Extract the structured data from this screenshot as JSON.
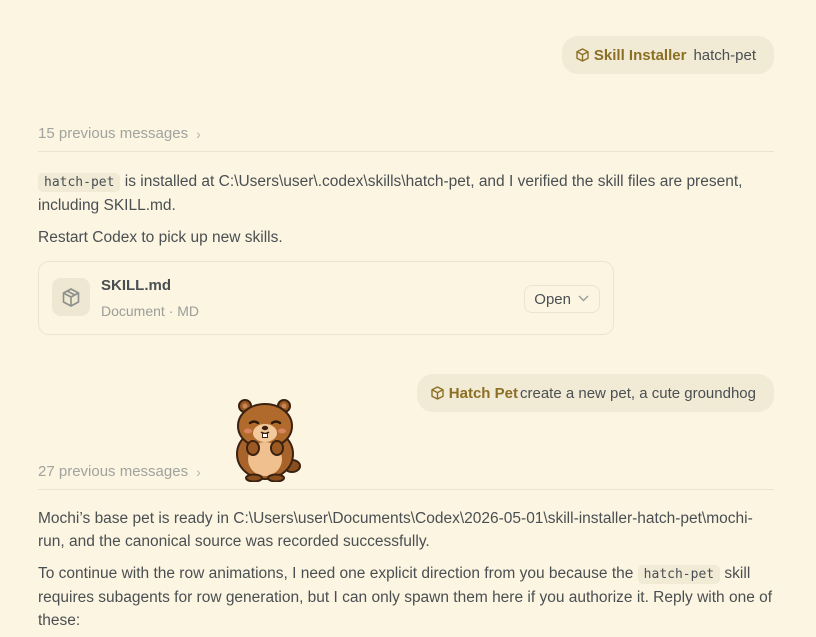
{
  "messages": {
    "first_request": {
      "skill_name": "Skill Installer",
      "text": "hatch-pet"
    },
    "first_previous": {
      "label": "15 previous messages",
      "chevron": "›"
    },
    "first_reply": {
      "code": "hatch-pet",
      "line1": " is installed at C:\\Users\\user\\.codex\\skills\\hatch-pet, and I verified the skill files are present, including SKILL.md.",
      "line2": "Restart Codex to pick up new skills."
    },
    "file_card": {
      "name": "SKILL.md",
      "meta": "Document · MD",
      "open_label": "Open",
      "icon": "package-icon"
    },
    "second_request": {
      "skill_name": "Hatch Pet",
      "text": "create a new pet, a cute groundhog"
    },
    "second_previous": {
      "label": "27 previous messages",
      "chevron": "›"
    },
    "second_reply": {
      "para1": "Mochi’s base pet is ready in C:\\Users\\user\\Documents\\Codex\\2026-05-01\\skill-installer-hatch-pet\\mochi-run, and the canonical source was recorded successfully.",
      "para2_before": "To continue with the row animations, I need one explicit direction from you because the ",
      "para2_code": "hatch-pet",
      "para2_after": " skill requires subagents for row generation, but I can only spawn them here if you authorize it. Reply with one of these:"
    }
  },
  "colors": {
    "background": "#fcf5e2",
    "bubble": "#f1ead5",
    "skill_accent": "#8b6f24",
    "text": "#4a4f52",
    "muted": "#a0a39e"
  }
}
